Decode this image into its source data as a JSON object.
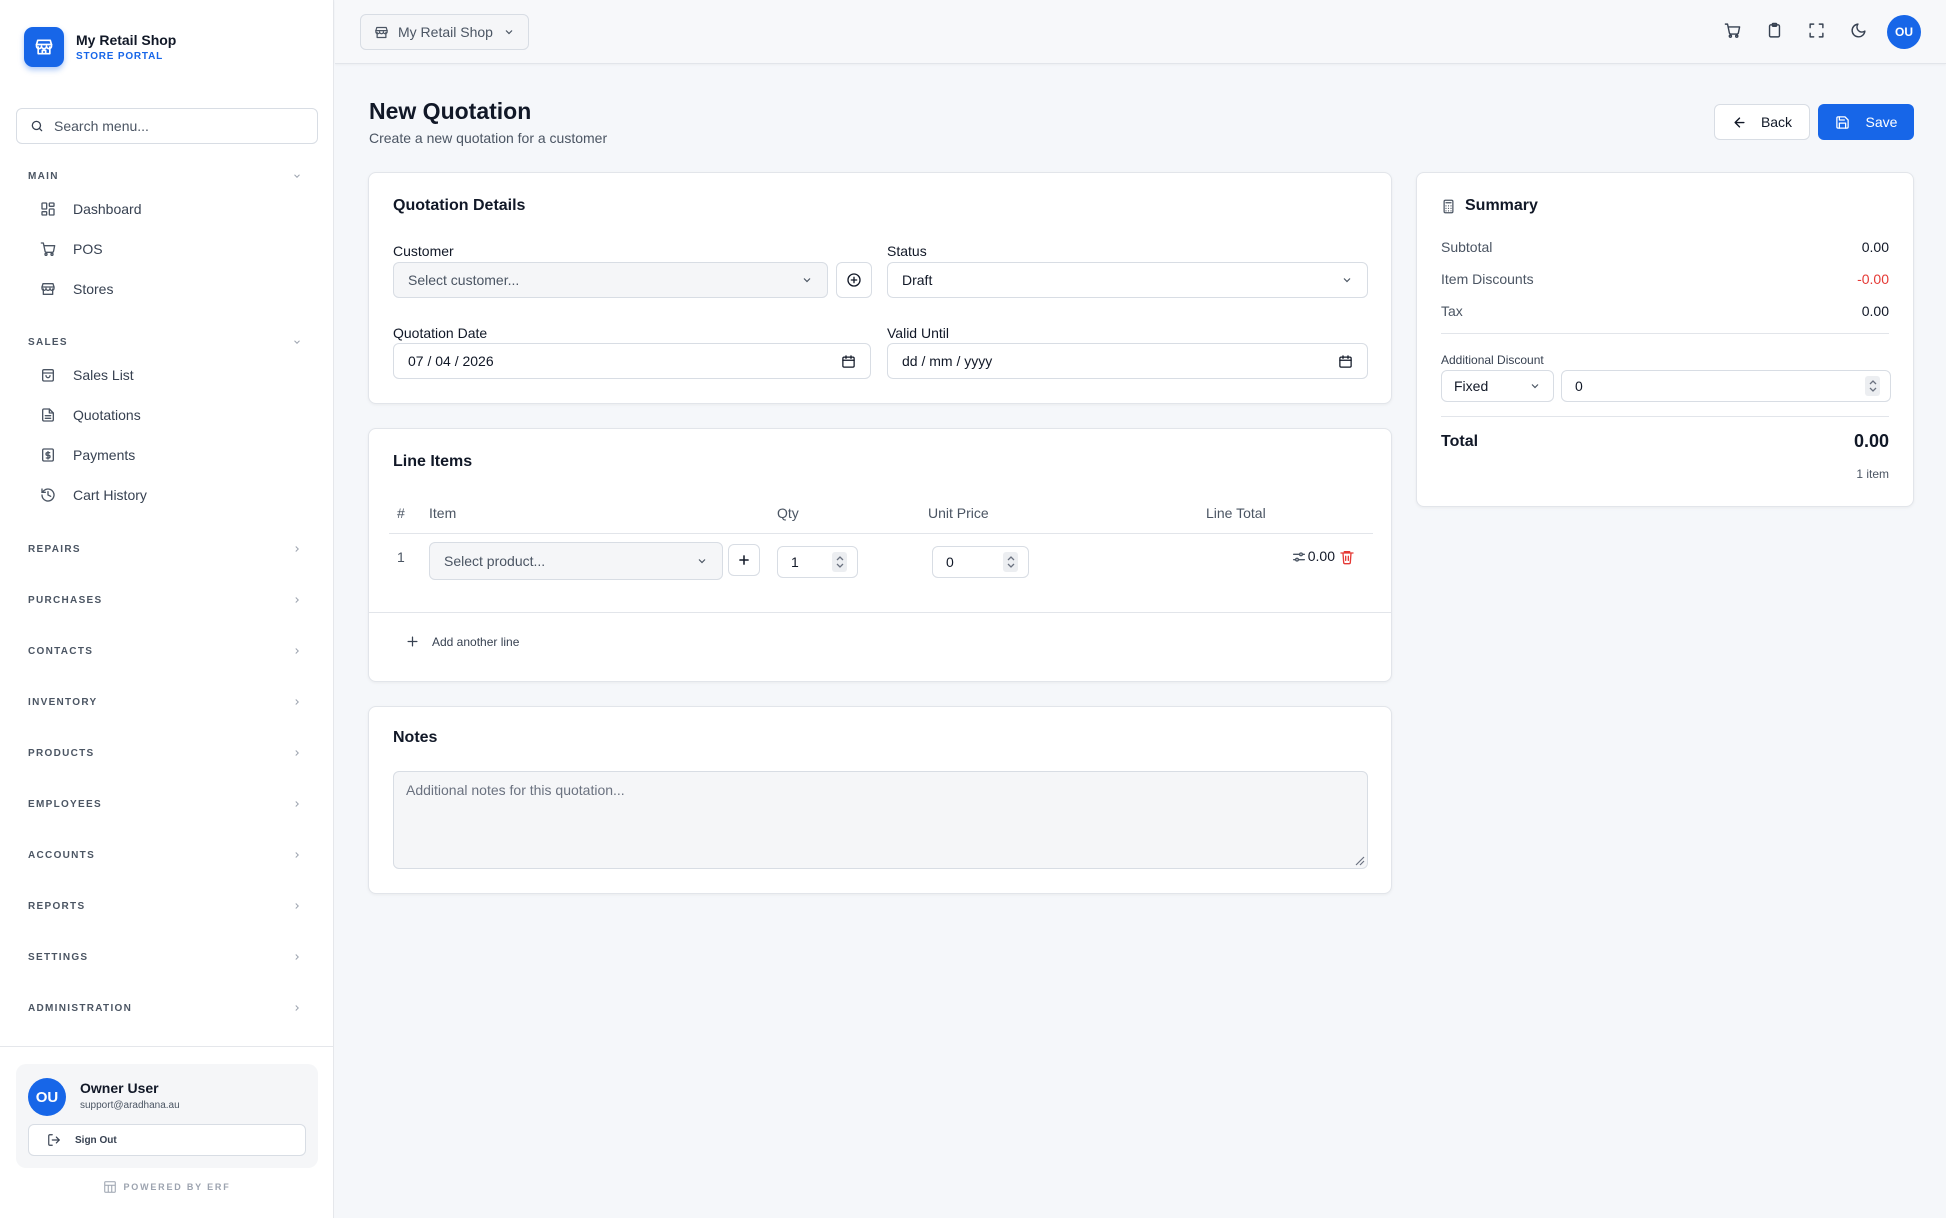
{
  "brand": {
    "name": "My Retail Shop",
    "subtitle": "STORE PORTAL"
  },
  "sidebar": {
    "search_placeholder": "Search menu...",
    "groups": [
      {
        "label": "MAIN",
        "expanded": true,
        "items": [
          {
            "label": "Dashboard",
            "icon": "grid-icon"
          },
          {
            "label": "POS",
            "icon": "cart-icon"
          },
          {
            "label": "Stores",
            "icon": "store-icon"
          }
        ]
      },
      {
        "label": "SALES",
        "expanded": true,
        "items": [
          {
            "label": "Sales List",
            "icon": "bag-icon"
          },
          {
            "label": "Quotations",
            "icon": "document-icon"
          },
          {
            "label": "Payments",
            "icon": "dollar-icon"
          },
          {
            "label": "Cart History",
            "icon": "history-icon"
          }
        ]
      },
      {
        "label": "REPAIRS",
        "expanded": false
      },
      {
        "label": "PURCHASES",
        "expanded": false
      },
      {
        "label": "CONTACTS",
        "expanded": false
      },
      {
        "label": "INVENTORY",
        "expanded": false
      },
      {
        "label": "PRODUCTS",
        "expanded": false
      },
      {
        "label": "EMPLOYEES",
        "expanded": false
      },
      {
        "label": "ACCOUNTS",
        "expanded": false
      },
      {
        "label": "REPORTS",
        "expanded": false
      },
      {
        "label": "SETTINGS",
        "expanded": false
      },
      {
        "label": "ADMINISTRATION",
        "expanded": false
      }
    ],
    "user": {
      "initials": "OU",
      "name": "Owner User",
      "email": "support@aradhana.au",
      "sign_out": "Sign Out"
    },
    "powered_by": "POWERED BY ERF"
  },
  "topbar": {
    "store_select": "My Retail Shop",
    "avatar_initials": "OU",
    "icons": [
      "cart-icon",
      "clipboard-icon",
      "fullscreen-icon",
      "moon-icon"
    ]
  },
  "page": {
    "title": "New Quotation",
    "subtitle": "Create a new quotation for a customer",
    "back_label": "Back",
    "save_label": "Save"
  },
  "details": {
    "title": "Quotation Details",
    "customer_label": "Customer",
    "customer_placeholder": "Select customer...",
    "status_label": "Status",
    "status_value": "Draft",
    "date_label": "Quotation Date",
    "date_value": "07 / 04 / 2026",
    "valid_label": "Valid Until",
    "valid_value": "dd / mm / yyyy"
  },
  "line_items": {
    "title": "Line Items",
    "headers": {
      "num": "#",
      "item": "Item",
      "qty": "Qty",
      "unit_price": "Unit Price",
      "line_total": "Line Total"
    },
    "rows": [
      {
        "num": "1",
        "product_placeholder": "Select product...",
        "qty": "1",
        "unit_price": "0",
        "line_total": "0.00"
      }
    ],
    "add_line": "Add another line"
  },
  "notes": {
    "title": "Notes",
    "placeholder": "Additional notes for this quotation..."
  },
  "summary": {
    "title": "Summary",
    "subtotal_label": "Subtotal",
    "subtotal": "0.00",
    "item_discounts_label": "Item Discounts",
    "item_discounts": "-0.00",
    "tax_label": "Tax",
    "tax": "0.00",
    "additional_discount_label": "Additional Discount",
    "discount_type": "Fixed",
    "discount_value": "0",
    "total_label": "Total",
    "total": "0.00",
    "item_count": "1 item"
  },
  "colors": {
    "accent": "#1766e8",
    "danger": "#e53935"
  }
}
